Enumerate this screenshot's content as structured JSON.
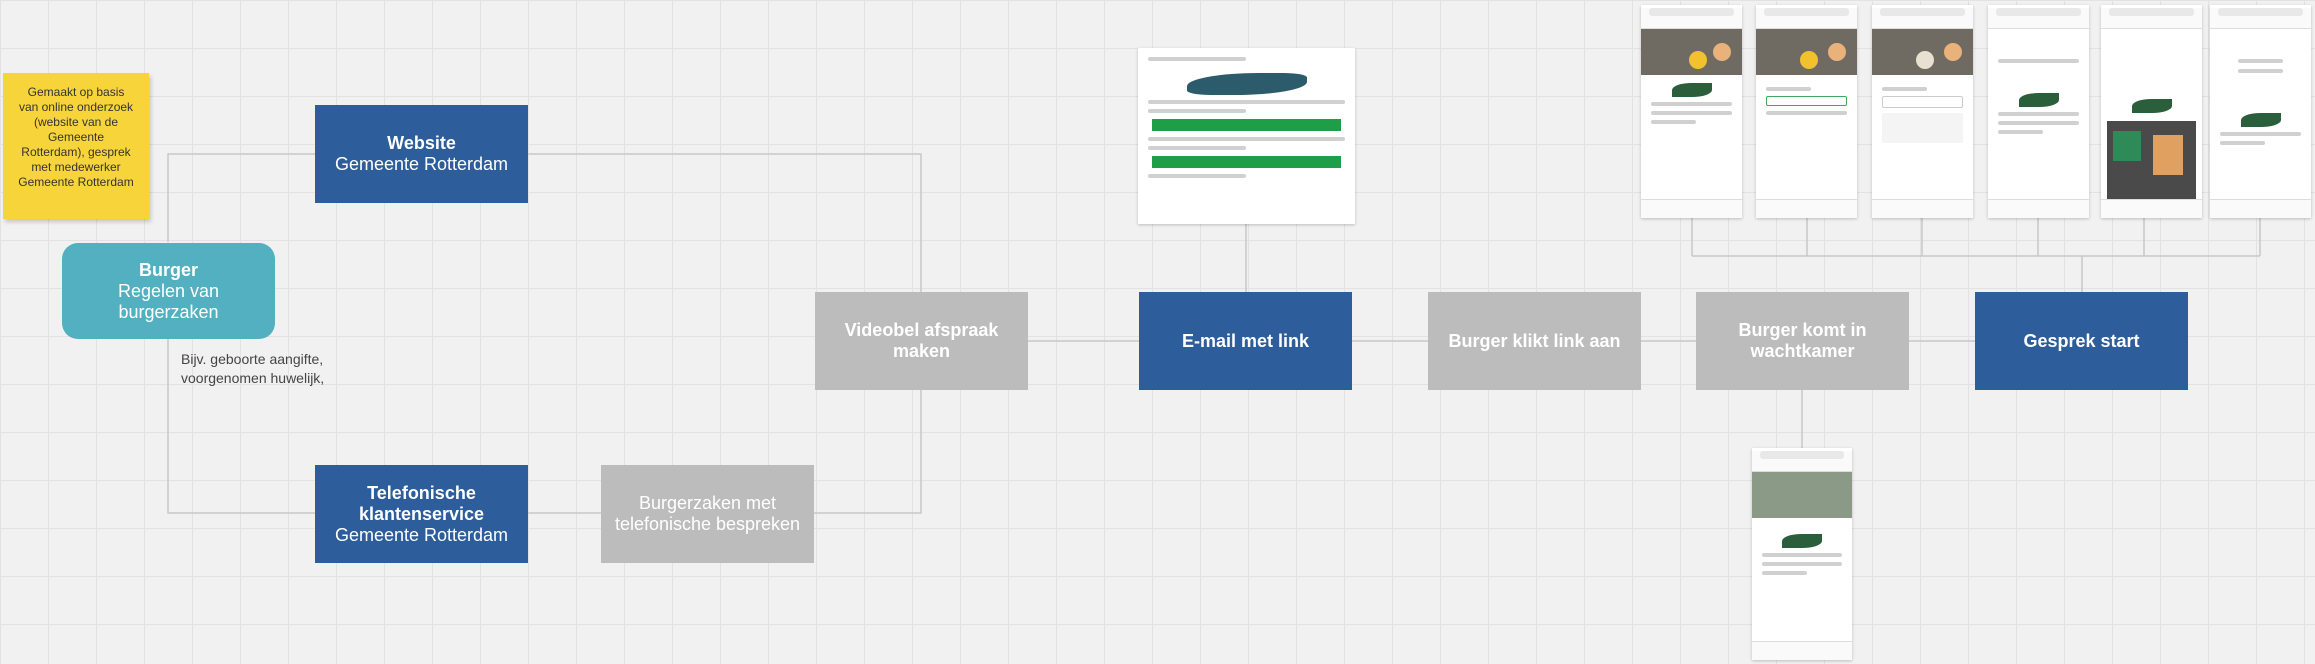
{
  "sticky_note": {
    "text": "Gemaakt op basis van online onderzoek (website van de Gemeente Rotterdam), gesprek met medewerker Gemeente Rotterdam"
  },
  "nodes": {
    "burger": {
      "title": "Burger",
      "subtitle": "Regelen van burgerzaken"
    },
    "website": {
      "title": "Website",
      "subtitle": "Gemeente Rotterdam"
    },
    "telefonisch": {
      "title": "Telefonische klantenservice",
      "subtitle": "Gemeente Rotterdam"
    },
    "burgerzaken_tel": {
      "label": "Burgerzaken met telefonische bespreken"
    },
    "videobel": {
      "label": "Videobel afspraak maken"
    },
    "email": {
      "label": "E-mail met link"
    },
    "klikt": {
      "label": "Burger klikt link aan"
    },
    "wachtkamer": {
      "label": "Burger komt in wachtkamer"
    },
    "gesprek": {
      "label": "Gesprek start"
    }
  },
  "note": {
    "line1": "Bijv. geboorte aangifte,",
    "line2": "voorgenomen huwelijk,"
  },
  "colors": {
    "blue_box": "#2d5d9a",
    "grey_box": "#bcbcbc",
    "teal_box": "#52b0c1",
    "sticky": "#f7d53a",
    "connector": "#c8c8c8"
  }
}
